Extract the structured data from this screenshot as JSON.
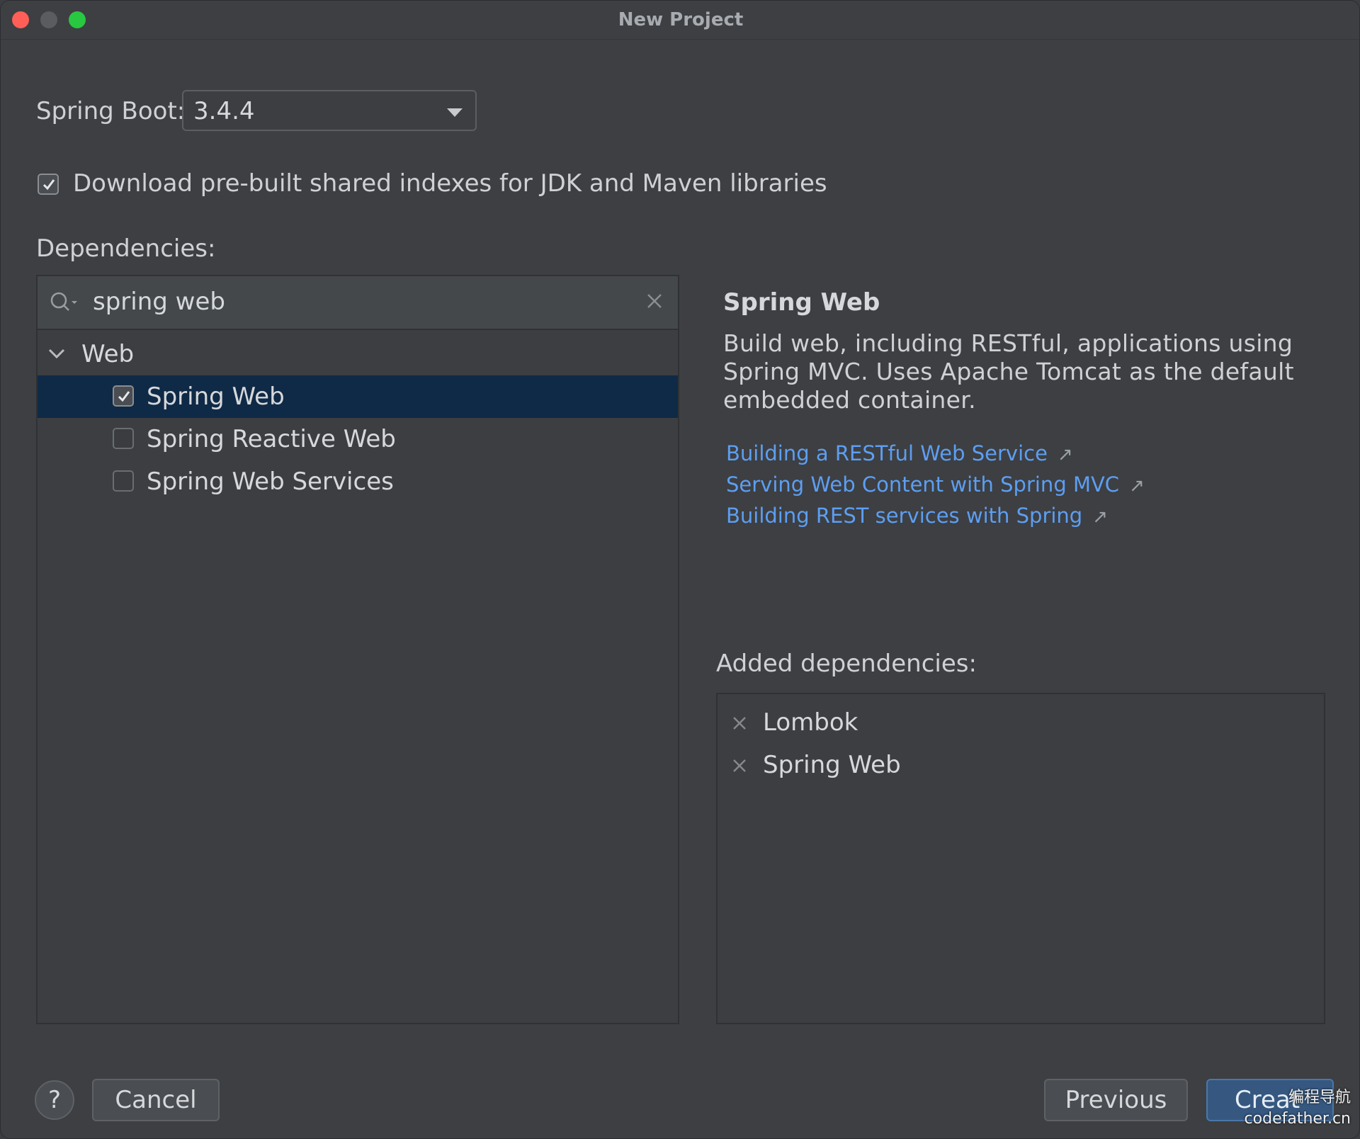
{
  "window": {
    "title": "New Project",
    "traffic_lights": {
      "close": "#ff5f57",
      "minimize": "#5a5c60",
      "maximize": "#28c840"
    }
  },
  "spring_boot": {
    "label": "Spring Boot:",
    "value": "3.4.4"
  },
  "download_indexes": {
    "label": "Download pre-built shared indexes for JDK and Maven libraries",
    "checked": true
  },
  "dependencies": {
    "label": "Dependencies:",
    "search": {
      "value": "spring web",
      "icon": "search-icon",
      "clear_icon": "close-icon"
    },
    "group": {
      "label": "Web",
      "expanded": true,
      "items": [
        {
          "label": "Spring Web",
          "checked": true,
          "selected": true
        },
        {
          "label": "Spring Reactive Web",
          "checked": false,
          "selected": false
        },
        {
          "label": "Spring Web Services",
          "checked": false,
          "selected": false
        }
      ]
    }
  },
  "detail": {
    "title": "Spring Web",
    "description": "Build web, including RESTful, applications using Spring MVC. Uses Apache Tomcat as the default embedded container.",
    "links": [
      "Building a RESTful Web Service",
      "Serving Web Content with Spring MVC",
      "Building REST services with Spring"
    ],
    "link_color": "#5d9ef2"
  },
  "added_dependencies": {
    "label": "Added dependencies:",
    "items": [
      "Lombok",
      "Spring Web"
    ]
  },
  "footer": {
    "help_label": "?",
    "cancel_label": "Cancel",
    "previous_label": "Previous",
    "create_label": "Creat",
    "primary_color": "#365880"
  },
  "watermark": {
    "line1": "编程导航",
    "line2": "codefather.cn"
  }
}
